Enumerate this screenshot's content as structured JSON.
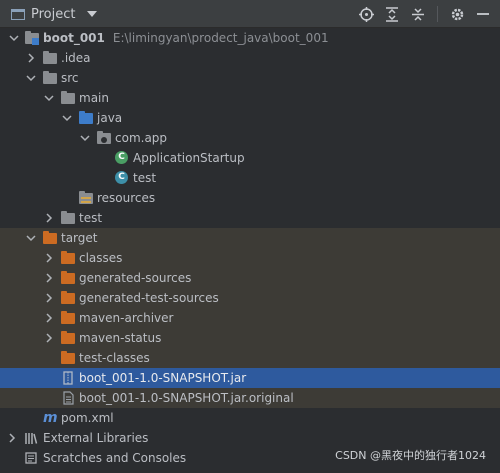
{
  "toolbar": {
    "title": "Project",
    "icons": [
      "locate-icon",
      "expand-all-icon",
      "collapse-all-icon",
      "gear-icon",
      "hide-icon"
    ]
  },
  "tree": {
    "root": {
      "name": "boot_001",
      "path": "E:\\limingyan\\prodect_java\\boot_001"
    },
    "idea": ".idea",
    "src": "src",
    "main": "main",
    "java": "java",
    "package": "com.app",
    "app_startup": "ApplicationStartup",
    "test_class": "test",
    "resources": "resources",
    "test_folder": "test",
    "target": "target",
    "classes": "classes",
    "generated_sources": "generated-sources",
    "generated_test_sources": "generated-test-sources",
    "maven_archiver": "maven-archiver",
    "maven_status": "maven-status",
    "test_classes": "test-classes",
    "jar": "boot_001-1.0-SNAPSHOT.jar",
    "jar_original": "boot_001-1.0-SNAPSHOT.jar.original",
    "pom": "pom.xml",
    "external_libraries": "External Libraries",
    "scratches": "Scratches and Consoles"
  },
  "watermark": "CSDN @黑夜中的独行者1024",
  "colors": {
    "background": "#2b2d30",
    "selection": "#2e5a9e",
    "excluded_highlight": "#3d3b36"
  }
}
